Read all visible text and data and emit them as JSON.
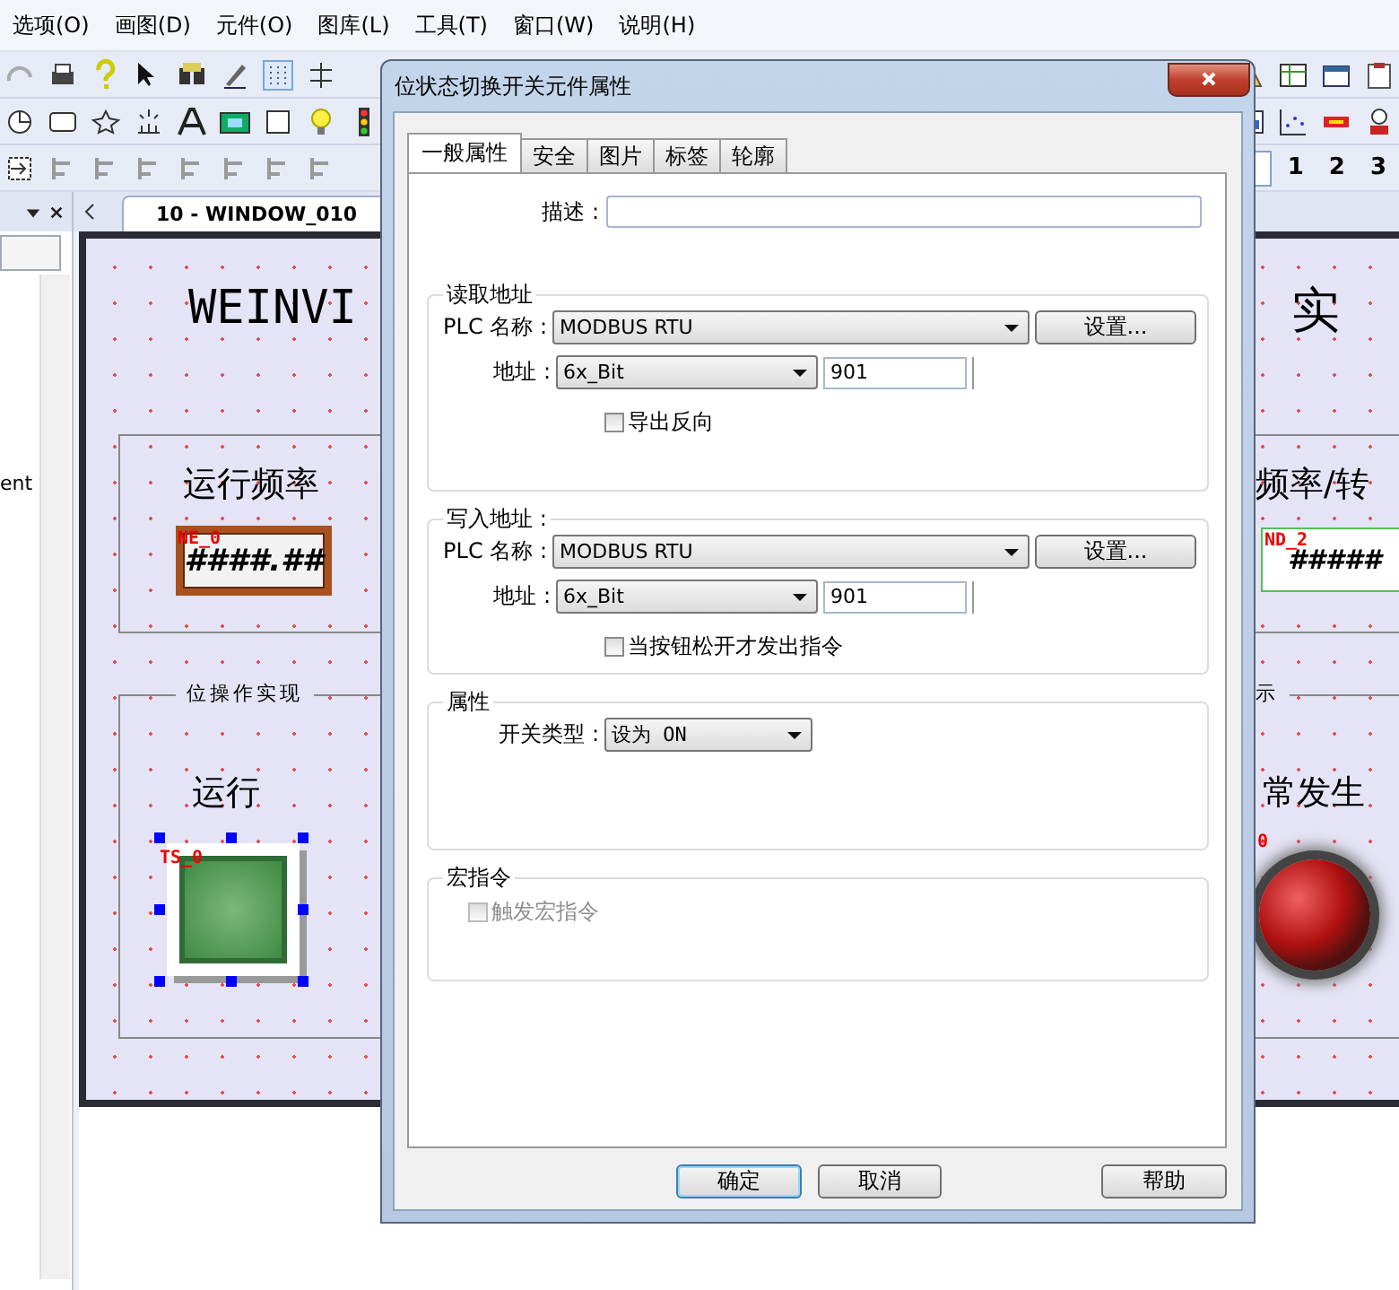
{
  "menu": [
    {
      "label": "选项(O)"
    },
    {
      "label": "画图(D)"
    },
    {
      "label": "元件(O)"
    },
    {
      "label": "图库(L)"
    },
    {
      "label": "工具(T)"
    },
    {
      "label": "窗口(W)"
    },
    {
      "label": "说明(H)"
    }
  ],
  "zoom_levels": [
    {
      "label": "1",
      "selected": false
    },
    {
      "label": "2",
      "selected": false
    },
    {
      "label": "3",
      "selected": false
    }
  ],
  "side_panel": {
    "text": "ent"
  },
  "document_tab": {
    "label": "10 - WINDOW_010"
  },
  "canvas": {
    "title_left": "WEINVI",
    "title_right": "实",
    "group_left": {
      "title": "运行频率",
      "tag": "NE_0",
      "value": "####.##"
    },
    "group_right": {
      "title": "频率/转",
      "tag": "ND_2",
      "value": "#####"
    },
    "bit_group": {
      "legend": "位操作实现",
      "label": "运行",
      "tag": "TS_0",
      "selected": true
    },
    "lamp_group": {
      "legend": "示",
      "label": "常发生",
      "tag": "0"
    }
  },
  "dialog": {
    "title": "位状态切换开关元件属性",
    "tabs": [
      {
        "label": "一般属性",
        "selected": true
      },
      {
        "label": "安全",
        "selected": false
      },
      {
        "label": "图片",
        "selected": false
      },
      {
        "label": "标签",
        "selected": false
      },
      {
        "label": "轮廓",
        "selected": false
      }
    ],
    "description": {
      "label": "描述 :"
    },
    "address_groups": [
      {
        "legend": "读取地址",
        "plc_label": "PLC 名称 :",
        "plc_value": "MODBUS RTU",
        "settings_button": "设置...",
        "address_label": "地址 :",
        "address_type": "6x_Bit",
        "address_value": "901",
        "checkbox": {
          "label": "导出反向",
          "checked": false
        }
      },
      {
        "legend": "写入地址 :",
        "plc_label": "PLC 名称 :",
        "plc_value": "MODBUS RTU",
        "settings_button": "设置...",
        "address_label": "地址 :",
        "address_type": "6x_Bit",
        "address_value": "901",
        "checkbox": {
          "label": "当按钮松开才发出指令",
          "checked": false
        }
      }
    ],
    "properties": {
      "legend": "属性",
      "switch_type_label": "开关类型 :",
      "switch_type_value": "设为 ON"
    },
    "macro": {
      "legend": "宏指令",
      "checkbox": {
        "label": "触发宏指令",
        "checked": false,
        "disabled": true
      }
    },
    "buttons": [
      {
        "label": "确定",
        "default": true
      },
      {
        "label": "取消",
        "default": false
      },
      {
        "label": "帮助",
        "default": false
      }
    ]
  }
}
